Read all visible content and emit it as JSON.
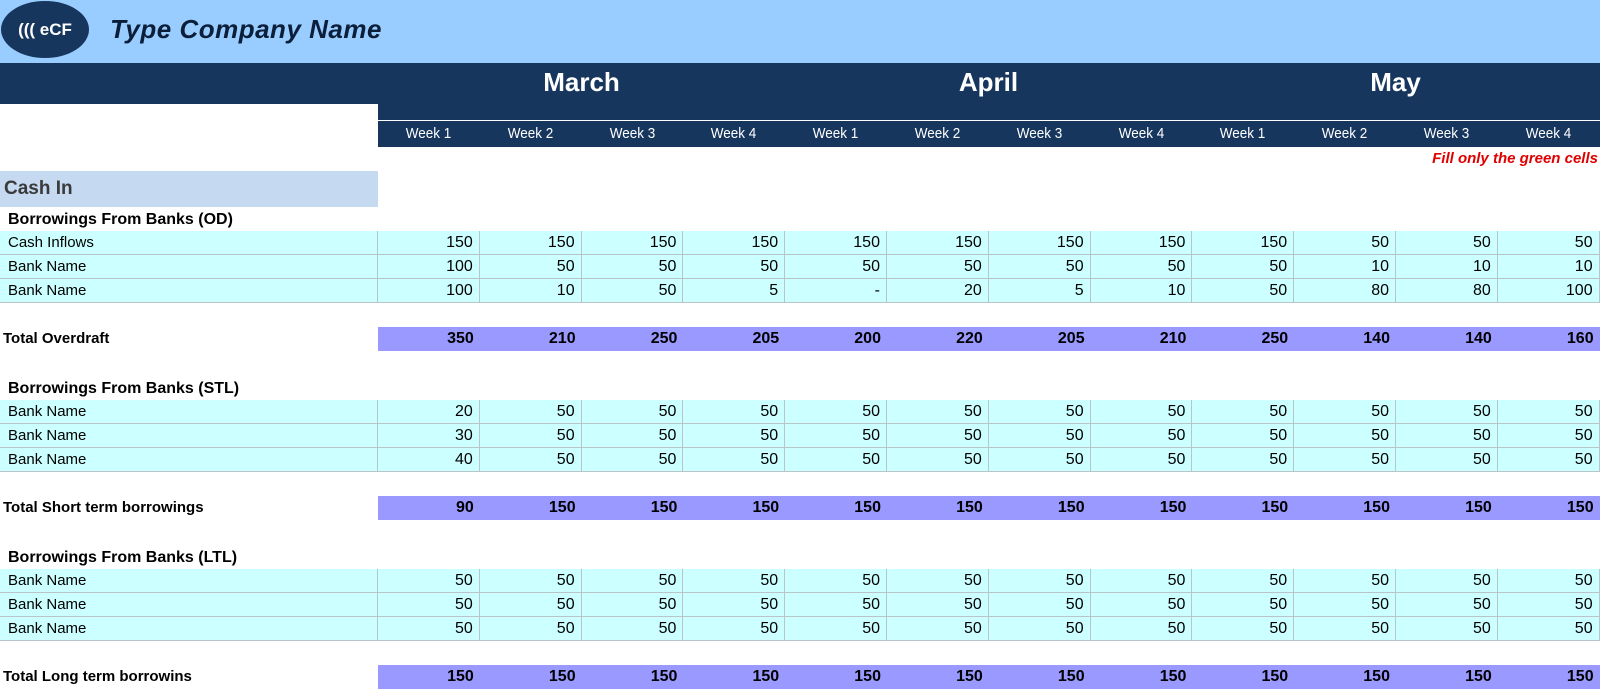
{
  "header": {
    "logo_text": "((( eCF",
    "company_name": "Type Company Name"
  },
  "months": [
    "March",
    "April",
    "May"
  ],
  "weeks": [
    "Week 1",
    "Week 2",
    "Week 3",
    "Week 4",
    "Week 1",
    "Week 2",
    "Week 3",
    "Week 4",
    "Week 1",
    "Week 2",
    "Week 3",
    "Week 4"
  ],
  "hint": "Fill only the green cells",
  "section_title": "Cash In",
  "groups": [
    {
      "title": "Borrowings From Banks (OD)",
      "rows": [
        {
          "label": "Cash Inflows",
          "values": [
            "150",
            "150",
            "150",
            "150",
            "150",
            "150",
            "150",
            "150",
            "150",
            "50",
            "50",
            "50"
          ]
        },
        {
          "label": "Bank Name",
          "values": [
            "100",
            "50",
            "50",
            "50",
            "50",
            "50",
            "50",
            "50",
            "50",
            "10",
            "10",
            "10"
          ]
        },
        {
          "label": "Bank Name",
          "values": [
            "100",
            "10",
            "50",
            "5",
            "-",
            "20",
            "5",
            "10",
            "50",
            "80",
            "80",
            "100"
          ]
        }
      ],
      "total": {
        "label": "Total Overdraft",
        "values": [
          "350",
          "210",
          "250",
          "205",
          "200",
          "220",
          "205",
          "210",
          "250",
          "140",
          "140",
          "160"
        ]
      }
    },
    {
      "title": "Borrowings  From Banks (STL)",
      "rows": [
        {
          "label": "Bank Name",
          "values": [
            "20",
            "50",
            "50",
            "50",
            "50",
            "50",
            "50",
            "50",
            "50",
            "50",
            "50",
            "50"
          ]
        },
        {
          "label": "Bank Name",
          "values": [
            "30",
            "50",
            "50",
            "50",
            "50",
            "50",
            "50",
            "50",
            "50",
            "50",
            "50",
            "50"
          ]
        },
        {
          "label": "Bank Name",
          "values": [
            "40",
            "50",
            "50",
            "50",
            "50",
            "50",
            "50",
            "50",
            "50",
            "50",
            "50",
            "50"
          ]
        }
      ],
      "total": {
        "label": "Total Short term borrowings",
        "values": [
          "90",
          "150",
          "150",
          "150",
          "150",
          "150",
          "150",
          "150",
          "150",
          "150",
          "150",
          "150"
        ]
      }
    },
    {
      "title": "Borrowings  From Banks (LTL)",
      "rows": [
        {
          "label": "Bank Name",
          "values": [
            "50",
            "50",
            "50",
            "50",
            "50",
            "50",
            "50",
            "50",
            "50",
            "50",
            "50",
            "50"
          ]
        },
        {
          "label": "Bank Name",
          "values": [
            "50",
            "50",
            "50",
            "50",
            "50",
            "50",
            "50",
            "50",
            "50",
            "50",
            "50",
            "50"
          ]
        },
        {
          "label": "Bank Name",
          "values": [
            "50",
            "50",
            "50",
            "50",
            "50",
            "50",
            "50",
            "50",
            "50",
            "50",
            "50",
            "50"
          ]
        }
      ],
      "total": {
        "label": "Total Long term borrowins",
        "values": [
          "150",
          "150",
          "150",
          "150",
          "150",
          "150",
          "150",
          "150",
          "150",
          "150",
          "150",
          "150"
        ]
      }
    }
  ]
}
